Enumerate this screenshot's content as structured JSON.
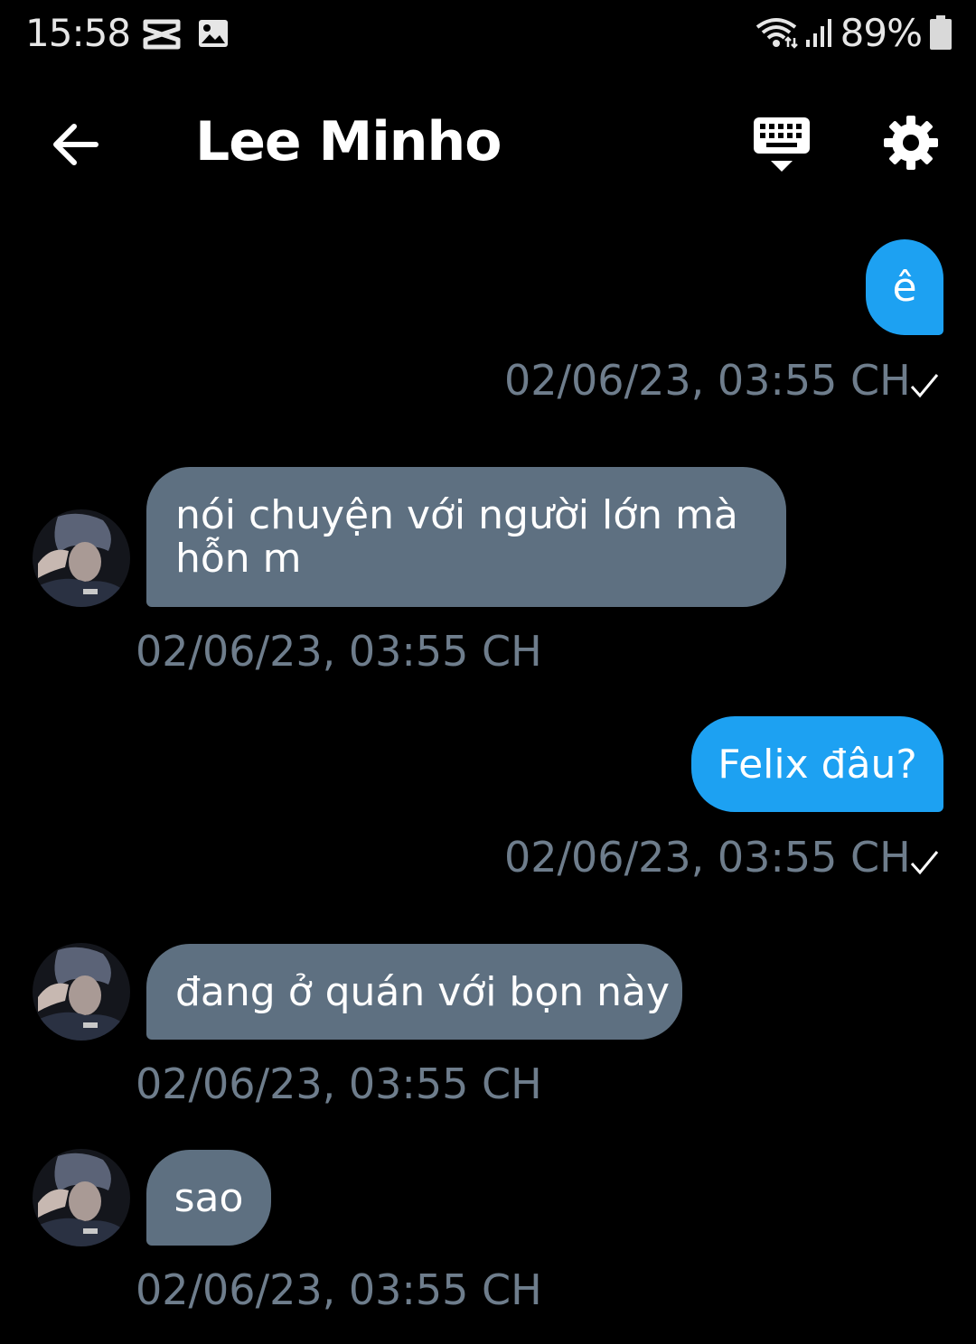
{
  "status_bar": {
    "time": "15:58",
    "battery": "89%",
    "icons": [
      "capcut-icon",
      "gallery-icon",
      "wifi-icon",
      "signal-icon",
      "battery-icon"
    ]
  },
  "header": {
    "contact_name": "Lee Minho",
    "back_icon": "back-arrow-icon",
    "keyboard_icon": "keyboard-icon",
    "settings_icon": "gear-icon"
  },
  "messages": [
    {
      "direction": "out",
      "text": "ê",
      "timestamp": "02/06/23, 03:55 CH",
      "status_icon": "checkmark-icon"
    },
    {
      "direction": "in",
      "text_lines": [
        "nói chuyện với người lớn mà",
        "hỗn m"
      ],
      "timestamp": "02/06/23, 03:55 CH"
    },
    {
      "direction": "out",
      "text": "Felix đâu?",
      "timestamp": "02/06/23, 03:55 CH",
      "status_icon": "checkmark-icon"
    },
    {
      "direction": "in",
      "text": "đang ở quán với bọn này",
      "timestamp": "02/06/23, 03:55 CH"
    },
    {
      "direction": "in",
      "text": "sao",
      "timestamp": "02/06/23, 03:55 CH"
    }
  ],
  "colors": {
    "background": "#000000",
    "outgoing_bubble": "#1da1f2",
    "incoming_bubble": "#5e7081",
    "timestamp": "#6e7d8c"
  }
}
